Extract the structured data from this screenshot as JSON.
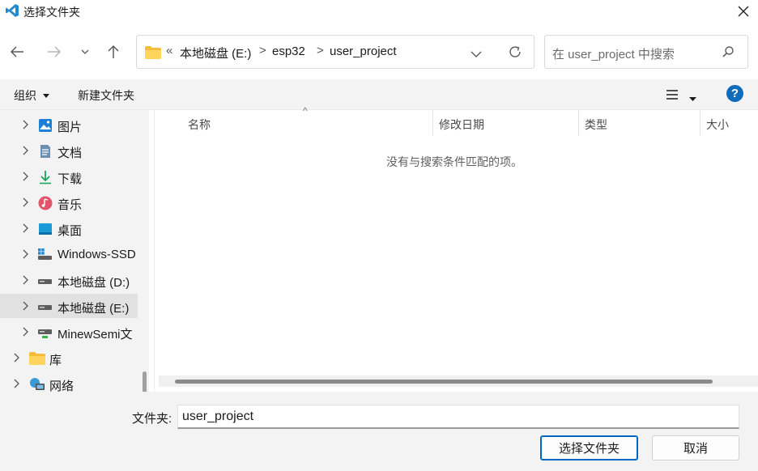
{
  "window": {
    "title": "选择文件夹"
  },
  "address": {
    "overflow_marker": "«",
    "crumbs": [
      "本地磁盘 (E:)",
      "esp32",
      "user_project"
    ],
    "separator": ">"
  },
  "search": {
    "placeholder": "在 user_project 中搜索"
  },
  "toolbar": {
    "organize_label": "组织",
    "new_folder_label": "新建文件夹",
    "help_label": "?"
  },
  "sidebar": {
    "items": [
      {
        "label": "图片",
        "icon": "pictures-icon"
      },
      {
        "label": "文档",
        "icon": "documents-icon"
      },
      {
        "label": "下载",
        "icon": "download-icon"
      },
      {
        "label": "音乐",
        "icon": "music-icon"
      },
      {
        "label": "桌面",
        "icon": "desktop-icon"
      },
      {
        "label": "Windows-SSD",
        "icon": "windows-drive-icon"
      },
      {
        "label": "本地磁盘 (D:)",
        "icon": "drive-icon"
      },
      {
        "label": "本地磁盘 (E:)",
        "icon": "drive-icon",
        "selected": true
      },
      {
        "label": "MinewSemi文",
        "icon": "network-drive-icon"
      },
      {
        "label": "库",
        "icon": "library-folder-icon"
      },
      {
        "label": "网络",
        "icon": "network-icon"
      }
    ]
  },
  "content": {
    "columns": [
      "名称",
      "修改日期",
      "类型",
      "大小"
    ],
    "empty_message": "没有与搜索条件匹配的项。"
  },
  "footer": {
    "folder_label": "文件夹:",
    "folder_value": "user_project",
    "select_button": "选择文件夹",
    "cancel_button": "取消"
  },
  "colors": {
    "accent": "#0067c0",
    "help_circle": "#0f6cbd",
    "vscode_blue": "#1f8ad2"
  }
}
